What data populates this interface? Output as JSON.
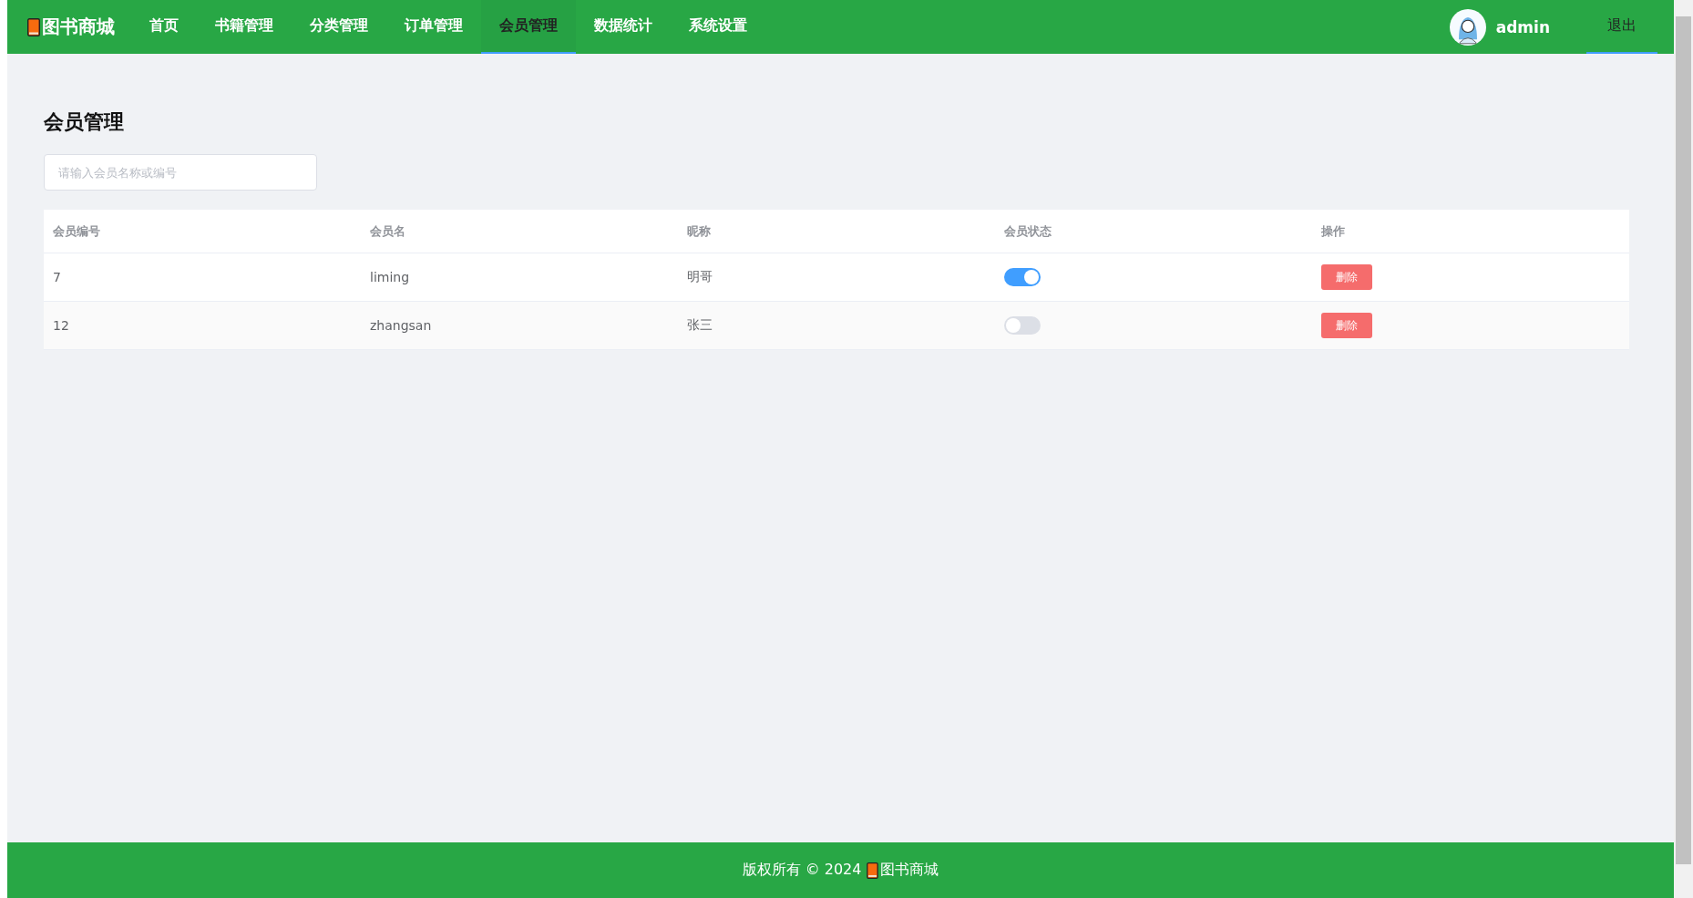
{
  "header": {
    "logo": "图书商城",
    "nav": [
      {
        "label": "首页",
        "selected": false
      },
      {
        "label": "书籍管理",
        "selected": false
      },
      {
        "label": "分类管理",
        "selected": false
      },
      {
        "label": "订单管理",
        "selected": false
      },
      {
        "label": "会员管理",
        "selected": true
      },
      {
        "label": "数据统计",
        "selected": false
      },
      {
        "label": "系统设置",
        "selected": false
      }
    ],
    "user": "admin",
    "logout": {
      "label": "退出",
      "selected": true
    }
  },
  "page_title": "会员管理",
  "search": {
    "placeholder": "请输入会员名称或编号"
  },
  "table": {
    "columns": [
      "会员编号",
      "会员名",
      "昵称",
      "会员状态",
      "操作"
    ],
    "rows": [
      {
        "id": "7",
        "name": "liming",
        "nickname": "明哥",
        "on": true,
        "action": "删除"
      },
      {
        "id": "12",
        "name": "zhangsan",
        "nickname": "张三",
        "on": false,
        "action": "删除"
      }
    ]
  },
  "footer": {
    "copyright": "版权所有 © 2024",
    "brand": "图书商城"
  }
}
